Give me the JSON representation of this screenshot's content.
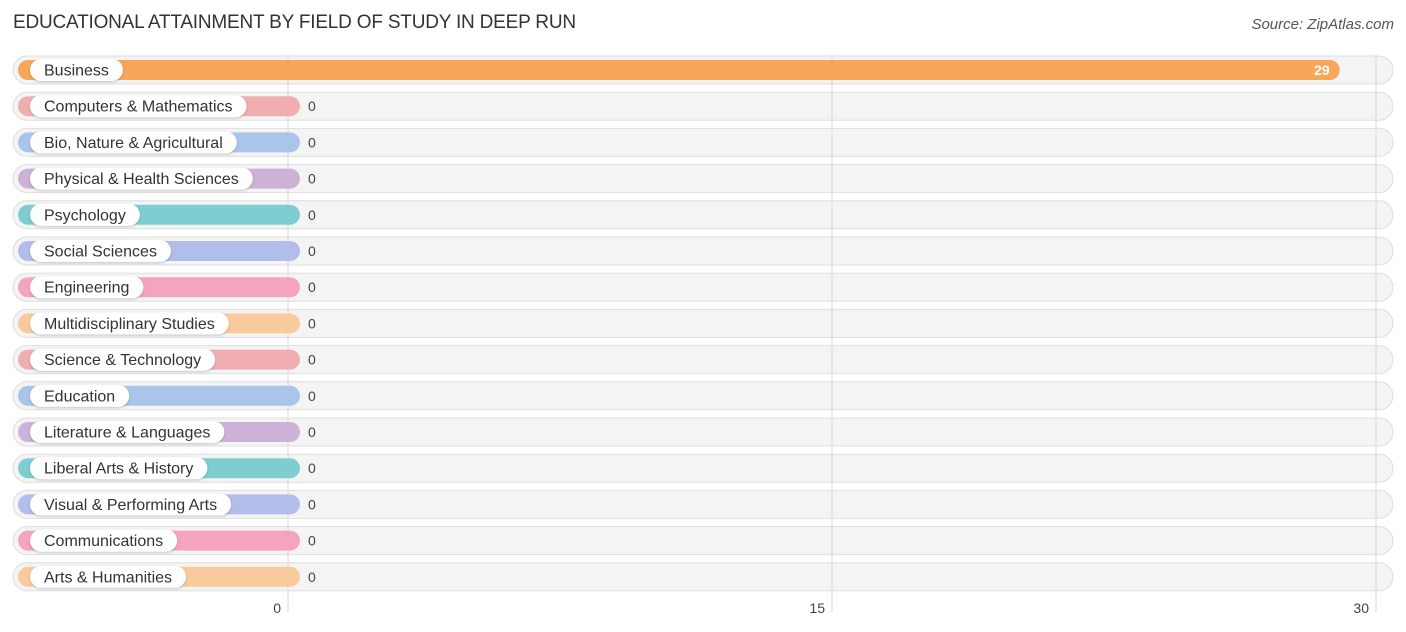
{
  "header": {
    "title": "EDUCATIONAL ATTAINMENT BY FIELD OF STUDY IN DEEP RUN",
    "source": "Source: ZipAtlas.com"
  },
  "chart_data": {
    "type": "bar",
    "orientation": "horizontal",
    "title": "EDUCATIONAL ATTAINMENT BY FIELD OF STUDY IN DEEP RUN",
    "xlabel": "",
    "ylabel": "",
    "xlim": [
      0,
      30
    ],
    "xticks": [
      0,
      15,
      30
    ],
    "grid": true,
    "categories": [
      "Business",
      "Computers & Mathematics",
      "Bio, Nature & Agricultural",
      "Physical & Health Sciences",
      "Psychology",
      "Social Sciences",
      "Engineering",
      "Multidisciplinary Studies",
      "Science & Technology",
      "Education",
      "Literature & Languages",
      "Liberal Arts & History",
      "Visual & Performing Arts",
      "Communications",
      "Arts & Humanities"
    ],
    "values": [
      29,
      0,
      0,
      0,
      0,
      0,
      0,
      0,
      0,
      0,
      0,
      0,
      0,
      0,
      0
    ],
    "colors": [
      "#f7a65a",
      "#f0aeb1",
      "#a9c6ea",
      "#ccb2d6",
      "#7ecdd0",
      "#b3bdea",
      "#f5a4c0",
      "#f9ca9c",
      "#f0aeb1",
      "#a9c6ea",
      "#ccb2d6",
      "#7ecdd0",
      "#b3bdea",
      "#f5a4c0",
      "#f9ca9c"
    ]
  }
}
